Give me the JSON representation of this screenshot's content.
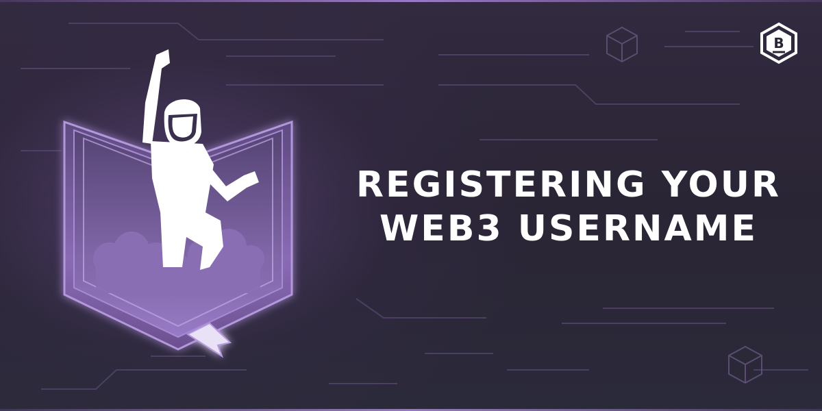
{
  "banner": {
    "title_line_1": "REGISTERING YOUR",
    "title_line_2": "WEB3 USERNAME",
    "logo_letter": "B"
  },
  "colors": {
    "background": "#2b2536",
    "accent_purple": "#9b7bc9",
    "book_fill": "#6a4f8f",
    "text": "#ffffff"
  },
  "icons": [
    "circuit-lines",
    "cube-icon",
    "book-icon",
    "person-silhouette",
    "cloud-icon",
    "brand-logo-icon"
  ]
}
